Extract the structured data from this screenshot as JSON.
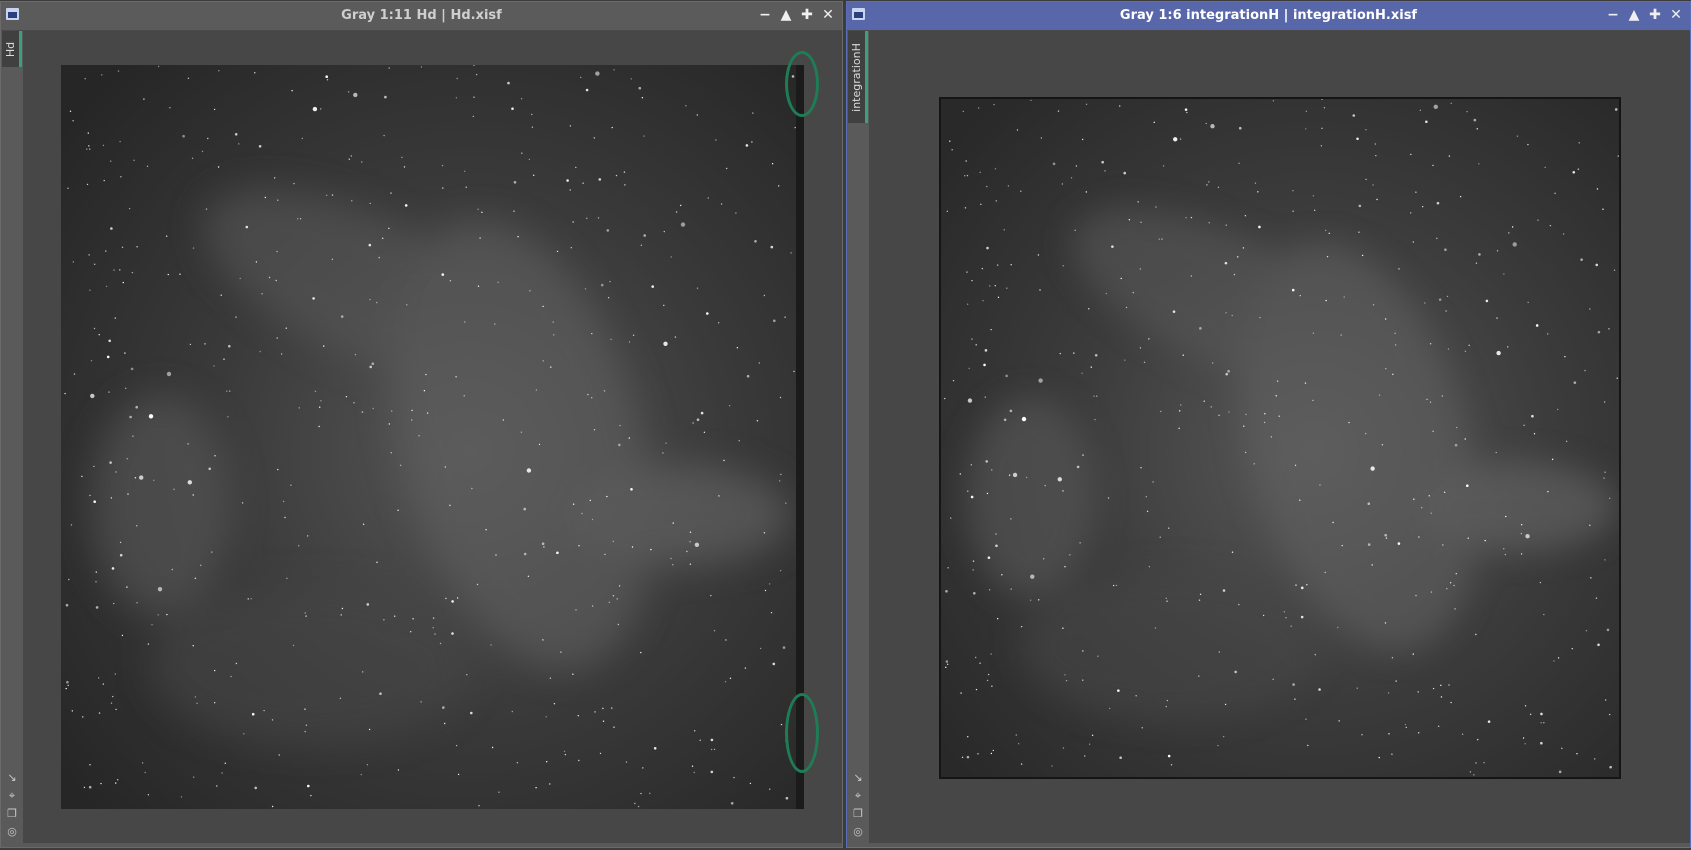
{
  "windows": [
    {
      "title": "Gray 1:11 Hd | Hd.xisf",
      "tab_label": "Hd",
      "active": false,
      "image_name": "nebula-starfield-image",
      "highlight_marks": 2,
      "highlight_color": "#1e7d56"
    },
    {
      "title": "Gray 1:6 integrationH | integrationH.xisf",
      "tab_label": "integrationH",
      "active": true,
      "image_name": "nebula-starfield-image"
    }
  ],
  "window_controls": {
    "minimize_icon": "minimize-icon",
    "shade_icon": "shade-icon",
    "maximize_icon": "maximize-icon",
    "close_icon": "close-icon"
  },
  "side_tools": [
    "fit-view-icon",
    "zoom-fit-icon",
    "clone-icon",
    "target-icon"
  ],
  "colors": {
    "active_titlebar": "#5867a9",
    "inactive_titlebar": "#5b5b5b",
    "tab_accent": "#3aa27a"
  }
}
